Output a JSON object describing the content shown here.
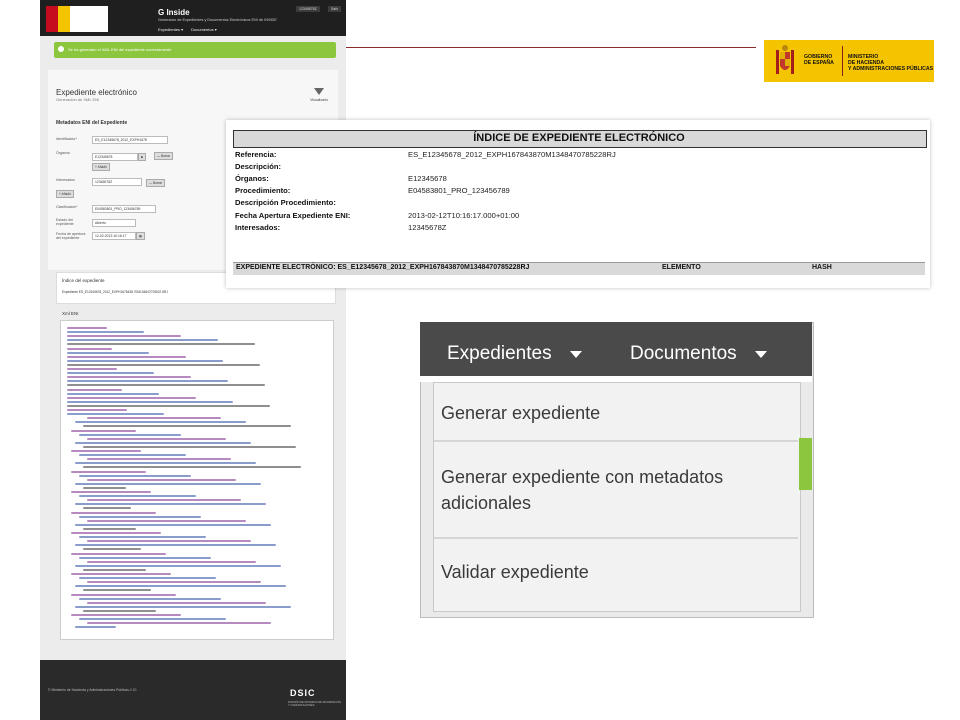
{
  "ginside": {
    "title": "G Inside",
    "subtitle": "Generador de Expedientes y Documentos Electrónicos ENI de INSIDE",
    "user": "12345678Z",
    "logout": "Salir",
    "nav": [
      "Expedientes ▾",
      "Documentos ▾"
    ],
    "success_msg": "Se ha generado el XML ENI del expediente correctamente",
    "page_title": "Expediente electrónico",
    "page_subtitle": "Generación de XML ENI",
    "visualize_label": "Visualizarlo",
    "metadata_title": "Metadatos ENI del Expediente",
    "fields": {
      "identificador_label": "Identificador*",
      "identificador_value": "ES_E12345678_2012_EXPH1678",
      "organos_label": "Órganos",
      "organos_value": "E12345678",
      "borrar": "— Borrar",
      "anadir": "+ Añadir",
      "interesados_label": "Interesados",
      "interesados_value": "12345678Z",
      "clasificacion_label": "Clasificación*",
      "clasificacion_value": "E04583801_PRO_123456789",
      "estado_label": "Estado del expediente",
      "estado_value": "Abierto",
      "fecha_label": "Fecha de apertura del expediente",
      "fecha_value": "12-02-2013 10:16:17"
    },
    "index_title": "Índice del expediente",
    "index_value": "Expediente ES_E12345678_2012_EXPH1678438 70M134847078522 8RJ",
    "xml_title": "Xml ENI",
    "footer": "© Ministerio de Hacienda y Administraciones Públicas // 10",
    "dsic": "DSIC",
    "dsic_sub": "DIVISIÓN DE SISTEMAS DE INFORMACIÓN Y COMUNICACIONES"
  },
  "gov": {
    "line1": "GOBIERNO",
    "line2": "DE ESPAÑA",
    "min1": "MINISTERIO",
    "min2": "DE HACIENDA",
    "min3": "Y ADMINISTRACIONES PÚBLICAS"
  },
  "index_doc": {
    "title": "ÍNDICE DE EXPEDIENTE ELECTRÓNICO",
    "rows": [
      {
        "label": "Referencia:",
        "value": "ES_E12345678_2012_EXPH167843870M1348470785228RJ"
      },
      {
        "label": "Descripción:",
        "value": ""
      },
      {
        "label": "Órganos:",
        "value": "E12345678"
      },
      {
        "label": "Procedimiento:",
        "value": "E04583801_PRO_123456789"
      },
      {
        "label": "Descripción Procedimiento:",
        "value": ""
      },
      {
        "label": "Fecha Apertura Expediente ENI:",
        "value": "2013-02-12T10:16:17.000+01:00"
      },
      {
        "label": "Interesados:",
        "value": "12345678Z"
      }
    ],
    "bar_label": "EXPEDIENTE ELECTRÓNICO: ES_E12345678_2012_EXPH167843870M1348470785228RJ",
    "bar_element": "ELEMENTO",
    "bar_hash": "HASH"
  },
  "menu": {
    "expedientes": "Expedientes",
    "documentos": "Documentos",
    "items": [
      "Generar expediente",
      "Generar expediente con metadatos",
      "adicionales",
      "Validar expediente"
    ]
  }
}
